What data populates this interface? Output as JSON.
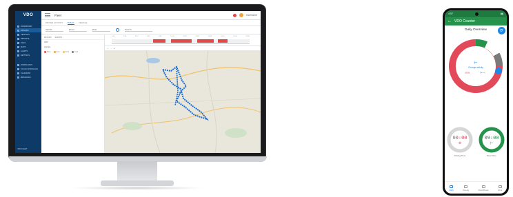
{
  "desktop": {
    "app": {
      "logo": "VDO",
      "title": "Fleet",
      "user_name": "Username"
    },
    "sidebar": {
      "items": [
        {
          "label": "DASHBOARD"
        },
        {
          "label": "DRIVERS"
        },
        {
          "label": "VEHICLES"
        },
        {
          "label": "REPORTS"
        },
        {
          "label": "FILES"
        },
        {
          "label": "MAPS"
        },
        {
          "label": "ALERTS"
        },
        {
          "label": "SETTINGS"
        },
        {
          "label": "DOWNLOADS"
        },
        {
          "label": "TACHO DOWNLOAD"
        },
        {
          "label": "CALENDAR"
        },
        {
          "label": "MESSAGES"
        }
      ],
      "footer": "VDO FLEET"
    },
    "tabs": [
      {
        "label": "DRIVER ACTIVITY"
      },
      {
        "label": "TRACK"
      },
      {
        "label": "VEHICLE"
      }
    ],
    "filters": [
      {
        "label": "Vehicle"
      },
      {
        "label": "Driver"
      },
      {
        "label": "Date"
      },
      {
        "label": "Search"
      }
    ],
    "left_panel": {
      "tabs": [
        {
          "label": "DETAILS"
        },
        {
          "label": "EVENTS"
        }
      ],
      "rows": [
        {
          "text": "VDO"
        },
        {
          "text": "Journey"
        }
      ],
      "legend": [
        {
          "label": "Drive",
          "color": "#e24a4a"
        },
        {
          "label": "Rest",
          "color": "#f2a33a"
        },
        {
          "label": "Work",
          "color": "#f2c14a"
        },
        {
          "label": "Avail",
          "color": "#7a7a7a"
        }
      ]
    },
    "timeline": {
      "ticks": [
        "0:00",
        "2:00",
        "4:00",
        "6:00",
        "8:00",
        "10:00",
        "12:00",
        "14:00",
        "16:00",
        "18:00",
        "20:00",
        "22:00"
      ]
    }
  },
  "phone": {
    "status_time": "4:57",
    "header_title": "VDO Counter",
    "screen_title": "Daily Overview",
    "center_label": "Change activity",
    "driving_time": "00:00",
    "driving_label": "Driving Time",
    "rest_time": "09:00",
    "rest_label": "Rest Time",
    "nav": [
      {
        "label": "Daily"
      },
      {
        "label": "Weekly"
      },
      {
        "label": "Rest&Break"
      },
      {
        "label": "Work"
      }
    ],
    "colors": {
      "green": "#26934c",
      "red": "#e24a5a",
      "blue": "#1e88e5"
    }
  }
}
